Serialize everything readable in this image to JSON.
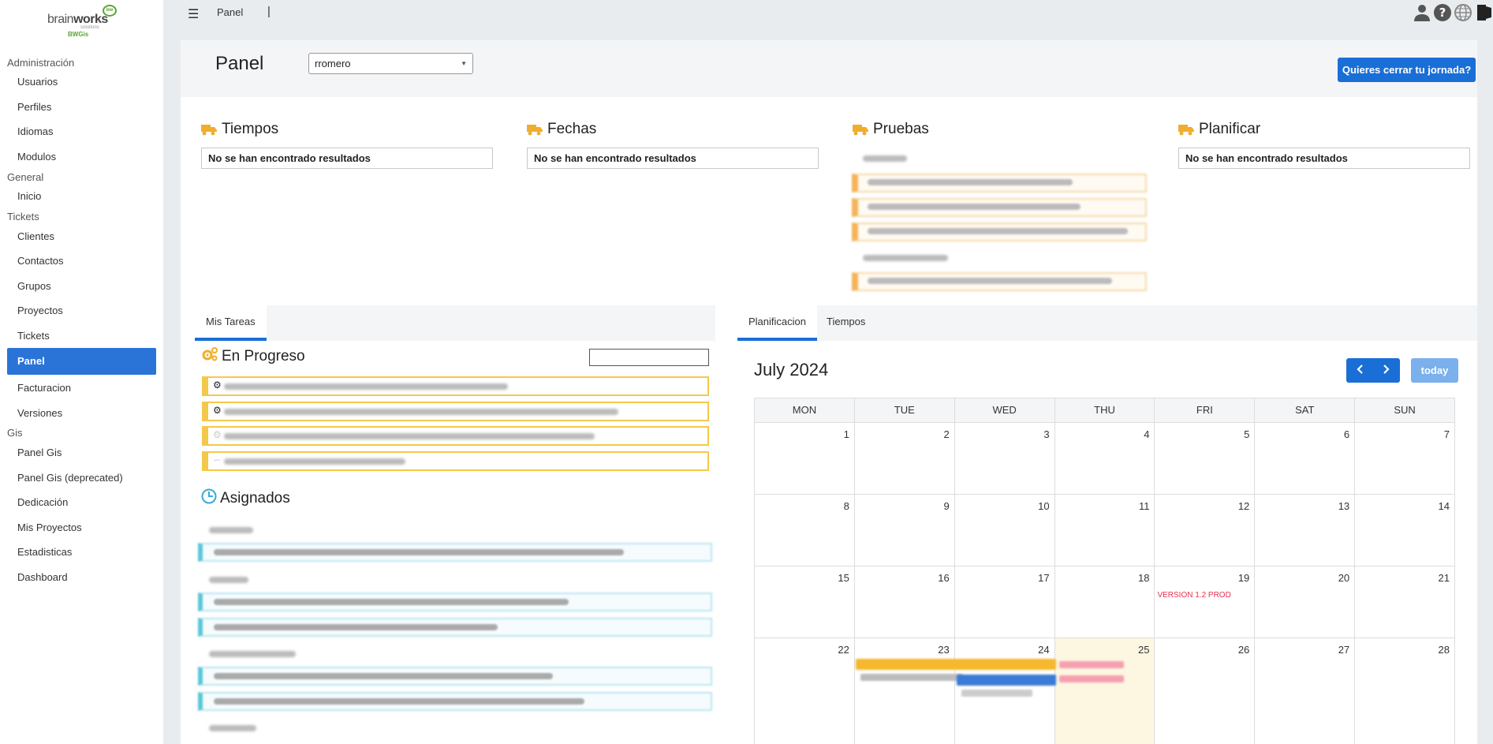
{
  "logo": {
    "brand_light": "brain",
    "brand_bold": "works",
    "solutions": "solutions",
    "sub": "BWGis",
    "bubble": "bw"
  },
  "sidebar": {
    "sections": [
      {
        "label": "Administración",
        "items": [
          "Usuarios",
          "Perfiles",
          "Idiomas",
          "Modulos"
        ]
      },
      {
        "label": "General",
        "items": [
          "Inicio"
        ]
      },
      {
        "label": "Tickets",
        "items": [
          "Clientes",
          "Contactos",
          "Grupos",
          "Proyectos",
          "Tickets",
          "Panel",
          "Facturacion",
          "Versiones"
        ]
      },
      {
        "label": "Gis",
        "items": [
          "Panel Gis",
          "Panel Gis (deprecated)",
          "Dedicación",
          "Mis Proyectos",
          "Estadisticas",
          "Dashboard"
        ]
      }
    ],
    "active_item": "Panel"
  },
  "topbar": {
    "title": "Panel",
    "separator": "|",
    "icons": [
      "user-icon",
      "help-icon",
      "globe-icon",
      "logout-icon"
    ]
  },
  "header": {
    "title": "Panel",
    "user_value": "rromero",
    "close_button": "Quieres cerrar tu jornada?"
  },
  "widgets": [
    {
      "title": "Tiempos",
      "empty": "No se han encontrado resultados"
    },
    {
      "title": "Fechas",
      "empty": "No se han encontrado resultados"
    },
    {
      "title": "Pruebas",
      "empty": ""
    },
    {
      "title": "Planificar",
      "empty": "No se han encontrado resultados"
    }
  ],
  "left_tabs": [
    "Mis Tareas"
  ],
  "right_tabs": [
    "Planificacion",
    "Tiempos"
  ],
  "en_progreso": {
    "title": "En Progreso"
  },
  "asignados": {
    "title": "Asignados"
  },
  "calendar": {
    "title": "July 2024",
    "today_label": "today",
    "weekdays": [
      "MON",
      "TUE",
      "WED",
      "THU",
      "FRI",
      "SAT",
      "SUN"
    ],
    "weeks": [
      [
        "1",
        "2",
        "3",
        "4",
        "5",
        "6",
        "7"
      ],
      [
        "8",
        "9",
        "10",
        "11",
        "12",
        "13",
        "14"
      ],
      [
        "15",
        "16",
        "17",
        "18",
        "19",
        "20",
        "21"
      ],
      [
        "22",
        "23",
        "24",
        "25",
        "26",
        "27",
        "28"
      ]
    ],
    "today": "25",
    "event": {
      "day": "19",
      "label": "VERSION 1.2 PROD"
    },
    "colors": {
      "accent": "#1a6fd6",
      "event": "#e8304f",
      "today_bg": "#fdf7e1"
    }
  }
}
